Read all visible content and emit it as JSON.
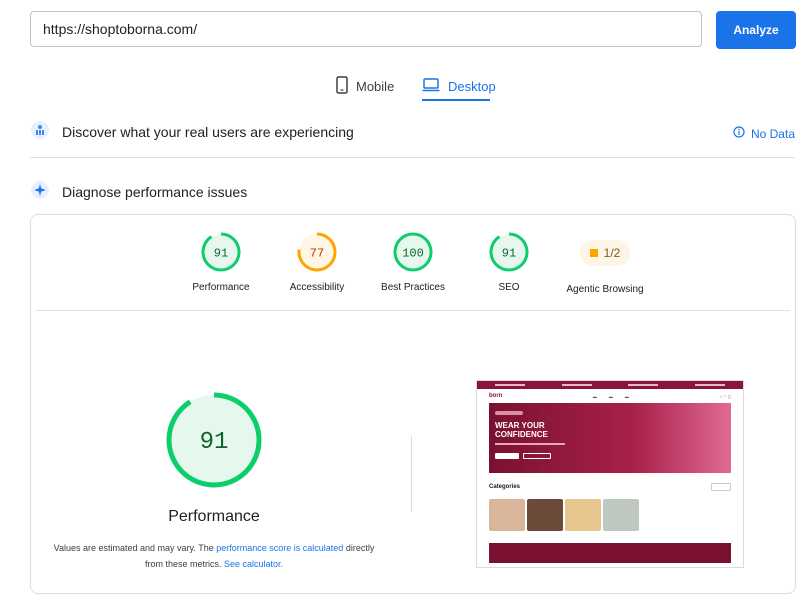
{
  "search": {
    "url": "https://shoptoborna.com/",
    "analyze_label": "Analyze"
  },
  "tabs": {
    "mobile": "Mobile",
    "desktop": "Desktop",
    "active": "Desktop"
  },
  "sections": {
    "discover": {
      "title": "Discover what your real users are experiencing",
      "status": "No Data"
    },
    "diagnose": {
      "title": "Diagnose performance issues"
    }
  },
  "scores": [
    {
      "label": "Performance",
      "value": "91",
      "fraction": 0.91,
      "color": "#0cce6b"
    },
    {
      "label": "Accessibility",
      "value": "77",
      "fraction": 0.77,
      "color": "#ffa400"
    },
    {
      "label": "Best Practices",
      "value": "100",
      "fraction": 1.0,
      "color": "#0cce6b"
    },
    {
      "label": "SEO",
      "value": "91",
      "fraction": 0.91,
      "color": "#0cce6b"
    }
  ],
  "agentic": {
    "label": "Agentic Browsing",
    "value": "1/2"
  },
  "main_score": {
    "value": "91",
    "fraction": 0.91,
    "label": "Performance"
  },
  "note": {
    "part1": "Values are estimated and may vary. The ",
    "link1": "performance score is calculated",
    "part2": " directly from these metrics. ",
    "link2": "See calculator."
  },
  "screenshot": {
    "logo": "born",
    "hero_title": "WEAR YOUR CONFIDENCE",
    "categories_title": "Categories"
  }
}
